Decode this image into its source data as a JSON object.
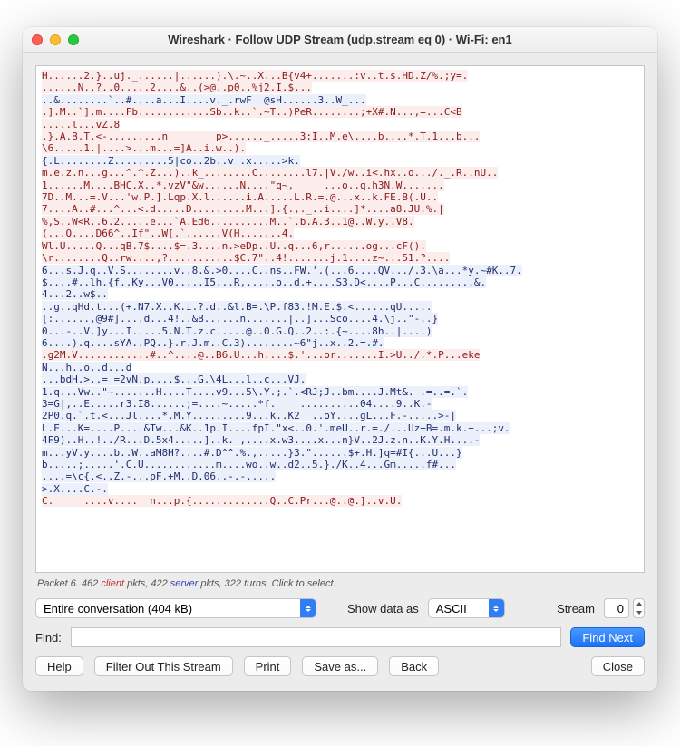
{
  "window": {
    "title": "Wireshark · Follow UDP Stream (udp.stream eq 0) · Wi-Fi: en1"
  },
  "stream": {
    "segments": [
      {
        "role": "client",
        "text": "H......2.}..uj._......|......).\\.~..X...B{v4+.......:v..t.s.HD.Z/%.;y=."
      },
      {
        "role": "client",
        "text": "......N..?..0.....2....&..(>@..p0..%j2.I.$..."
      },
      {
        "role": "server",
        "text": "..&........`..#....a...I....v._.rwF  @sH......3..W_..."
      },
      {
        "role": "client",
        "text": ".].M..`].m....Fb............Sb..k..`.~T..)PeR........;+X#.N...,=...C<B"
      },
      {
        "role": "client",
        "text": ".....l...vZ.8"
      },
      {
        "role": "client",
        "text": ".}.A.B.T.<-.........n        p>......_.....3:I..M.e\\....b....*.T.1...b..."
      },
      {
        "role": "client",
        "text": "\\6.....1.|....>...m...=]A..i.w..)."
      },
      {
        "role": "server",
        "text": "{.L........Z.........5|co..2b..v .x.....>k."
      },
      {
        "role": "client",
        "text": "m.e.z.n...g...^.^.Z...)..k_........C........l7.|V./w..i<.hx..o.../._.R..nU.."
      },
      {
        "role": "client",
        "text": "1......M....BHC.X..*.vzV\"&w......N....\"q~,     ...o..q.h3N.W......."
      },
      {
        "role": "client",
        "text": "7D..M...=.V...'w.P.].Lqp.X.l......i.A.....L.R.=.@...x..k.FE.B(.U.."
      },
      {
        "role": "client",
        "text": "7....A..#...^...<.d.....D.........M...].{.,._..i....]*....a8.JU.%.|"
      },
      {
        "role": "client",
        "text": "%,S..W<R..6.2.....e...`A.Ed6..........M..`.b.A.3..1@..W.y..V8."
      },
      {
        "role": "client",
        "text": "(...Q....D66^..If\"..W[.`......V(H.......4."
      },
      {
        "role": "client",
        "text": "Wl.U.....Q...qB.7$....$=.3....n.>eDp..U..q...6,r......og...cF()."
      },
      {
        "role": "client",
        "text": "\\r........Q..rw....,?...........$C.7\"..4!.......j.1....z~...51.?...."
      },
      {
        "role": "server",
        "text": "6...s.J.q..V.S........v..8.&.>0....C..ns..FW.'.(...6....QV.../.3.\\a...*y.~#K..7."
      },
      {
        "role": "server",
        "text": "$....#..lh.{f..Ky...V0.....I5...R,.....o..d.+....S3.D<....P...C.........&."
      },
      {
        "role": "server",
        "text": "4...2..w$.."
      },
      {
        "role": "server",
        "text": "..g..qHd.t...(+.N7.X..K.i.?.d..&l.B=.\\P.f83.!M.E.$.<......qU....."
      },
      {
        "role": "server",
        "text": "[:......,@9#]....d...4!..&B......n.......|..]...Sco....4.\\j..\"-..}"
      },
      {
        "role": "server",
        "text": "0...-..V.]y...I.....5.N.T.z.c.....@..0.G.Q..2..:.{~....8h..|....)"
      },
      {
        "role": "server",
        "text": "6....).q....sYA..PQ..}.r.J.m..C.3)........~6\"j..x..2.=.#."
      },
      {
        "role": "client",
        "text": ".g2M.V............#..^....@..B6.U...h....$.'...or.......I.>U../.*.P...eke"
      },
      {
        "role": "server",
        "text": "N...h..o..d...d"
      },
      {
        "role": "server",
        "text": "...bdH.>..= =2vN.p....$...G.\\4L...l..c...VJ."
      },
      {
        "role": "server",
        "text": "1.q...Vw..\"~.......H....T....v9...5\\.Y.;.`.<RJ;J..bm....J.Mt&. .=..=.`."
      },
      {
        "role": "server",
        "text": "3=G|,..E.....r3.I8......;=....~.....*f.    ..........04....9..K.-"
      },
      {
        "role": "server",
        "text": "2P0.q.`.t.<...Jl....*.M.Y.........9...k..K2  ..oY....gL...F.-.....>-|"
      },
      {
        "role": "server",
        "text": "L.E...K=....P....&Tw...&K..1p.I....fpI.\"x<..0.'.meU..r.=./...Uz+B=.m.k.+...;v."
      },
      {
        "role": "server",
        "text": "4F9)..H..!../R...D.5x4.....]..k. ,....x.w3....x...n}V..2J.z.n..K.Y.H....-"
      },
      {
        "role": "server",
        "text": "m...yV.y....b..W..aM8H?....#.D^^.%.,.....}3.\"......$+.H.]q=#I{...U...}"
      },
      {
        "role": "server",
        "text": "b.....;.....'.C.U............m....wo..w..d2..5.}./K..4...Gm.....f#..."
      },
      {
        "role": "server",
        "text": "....=\\c{.<..Z.-...pF.+M..D.06..-.-....."
      },
      {
        "role": "server",
        "text": ">.X....C.-."
      },
      {
        "role": "client",
        "text": "C.     ....v....  n...p.{.............Q..C.Pr...@..@.]..v.U."
      }
    ]
  },
  "status": {
    "prefix": "Packet 6. 462 ",
    "client_word": "client",
    "middle": " pkts, 422 ",
    "server_word": "server",
    "suffix": " pkts, 322 turns. Click to select."
  },
  "controls": {
    "conversation": {
      "selected": "Entire conversation (404 kB)"
    },
    "show_data_label": "Show data as",
    "format": {
      "selected": "ASCII"
    },
    "stream_label": "Stream",
    "stream_value": "0",
    "find_label": "Find:",
    "find_value": "",
    "find_next": "Find Next"
  },
  "buttons": {
    "help": "Help",
    "filter_out": "Filter Out This Stream",
    "print": "Print",
    "save_as": "Save as...",
    "back": "Back",
    "close": "Close"
  }
}
